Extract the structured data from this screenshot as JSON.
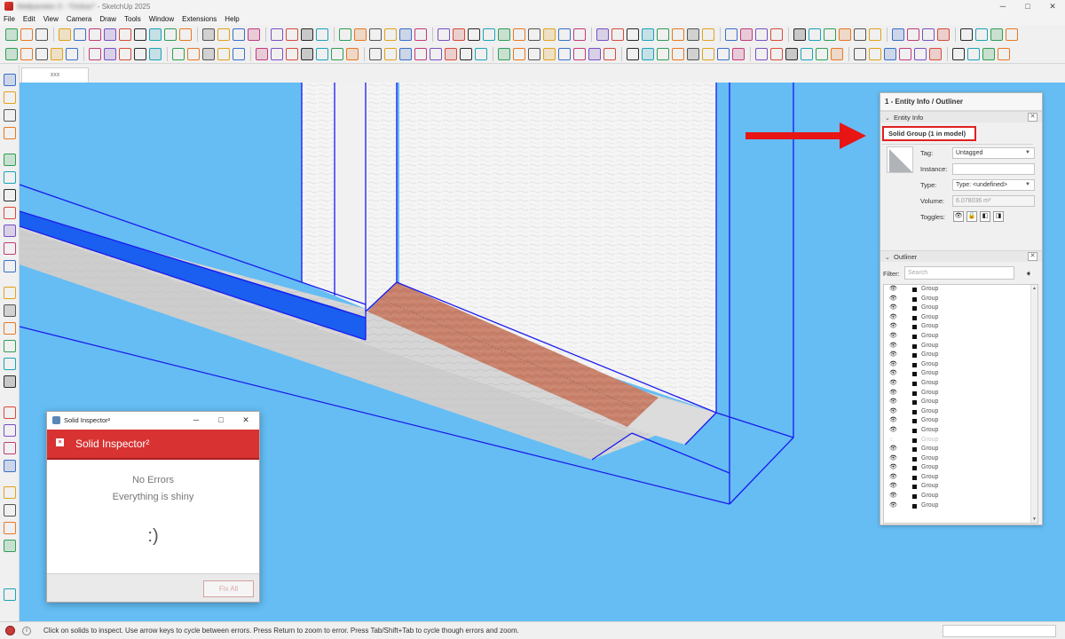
{
  "window": {
    "title_blurred": "Wallpanelen 3 - *Ordner*",
    "title_suffix": " - SketchUp 2025",
    "min": "─",
    "max": "□",
    "close": "✕"
  },
  "menu": [
    "File",
    "Edit",
    "View",
    "Camera",
    "Draw",
    "Tools",
    "Window",
    "Extensions",
    "Help"
  ],
  "scene_tab": "xxx",
  "status_bar": {
    "info": "i",
    "text": "Click on solids to inspect. Use arrow keys to cycle between errors. Press Return to zoom to error. Press Tab/Shift+Tab to cycle though errors and zoom."
  },
  "tray": {
    "title": "1 - Entity Info / Outliner",
    "entity_info": {
      "header": "Entity Info",
      "selection_label": "Solid Group (1 in model)",
      "fields": {
        "tag_label": "Tag:",
        "tag_value": "Untagged",
        "instance_label": "Instance:",
        "instance_value": "",
        "type_label": "Type:",
        "type_value": "Type: <undefined>",
        "volume_label": "Volume:",
        "volume_value": "6.078036 m³",
        "toggles_label": "Toggles:"
      }
    },
    "outliner": {
      "header": "Outliner",
      "filter_label": "Filter:",
      "search_placeholder": "Search",
      "items": [
        {
          "name": "Group",
          "hidden": false
        },
        {
          "name": "Group",
          "hidden": false
        },
        {
          "name": "Group",
          "hidden": false
        },
        {
          "name": "Group",
          "hidden": false
        },
        {
          "name": "Group",
          "hidden": false
        },
        {
          "name": "Group",
          "hidden": false
        },
        {
          "name": "Group",
          "hidden": false
        },
        {
          "name": "Group",
          "hidden": false
        },
        {
          "name": "Group",
          "hidden": false
        },
        {
          "name": "Group",
          "hidden": false
        },
        {
          "name": "Group",
          "hidden": false
        },
        {
          "name": "Group",
          "hidden": false
        },
        {
          "name": "Group",
          "hidden": false
        },
        {
          "name": "Group",
          "hidden": false
        },
        {
          "name": "Group",
          "hidden": false
        },
        {
          "name": "Group",
          "hidden": false
        },
        {
          "name": "Group",
          "hidden": true
        },
        {
          "name": "Group",
          "hidden": false
        },
        {
          "name": "Group",
          "hidden": false
        },
        {
          "name": "Group",
          "hidden": false
        },
        {
          "name": "Group",
          "hidden": false
        },
        {
          "name": "Group",
          "hidden": false
        },
        {
          "name": "Group",
          "hidden": false
        },
        {
          "name": "Group",
          "hidden": false
        }
      ]
    }
  },
  "solid_inspector": {
    "window_title": "Solid Inspector²",
    "heading": "Solid Inspector²",
    "line1": "No Errors",
    "line2": "Everything is shiny",
    "smiley": ":)",
    "fix_all": "Fix All"
  },
  "colors": {
    "viewport_sky": "#65bdf4",
    "edge_blue": "#1a1aee",
    "selection_red": "#e02020",
    "inspector_red": "#d83232"
  }
}
